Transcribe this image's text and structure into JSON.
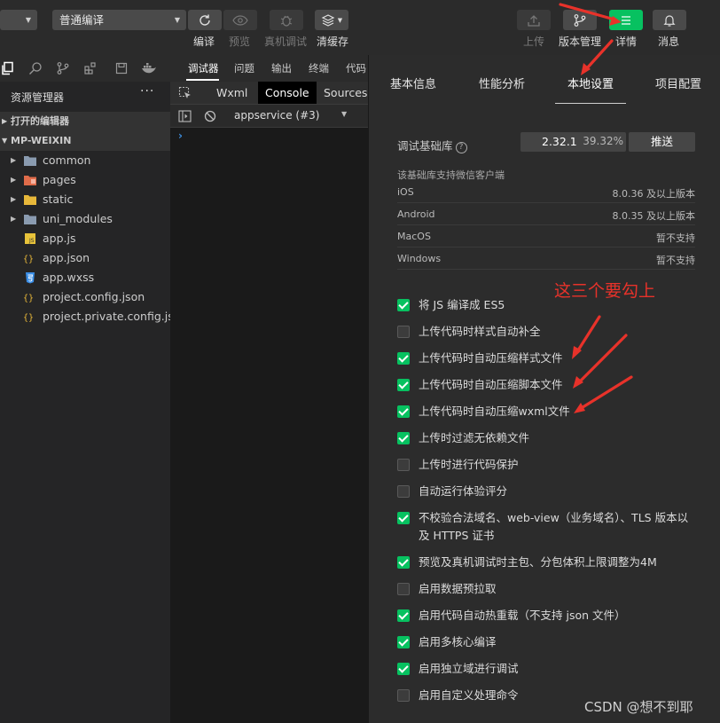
{
  "toolbar": {
    "compile_mode": "普通编译",
    "buttons": [
      {
        "label": "编译",
        "dim": false
      },
      {
        "label": "预览",
        "dim": true
      },
      {
        "label": "真机调试",
        "dim": true
      },
      {
        "label": "清缓存",
        "dim": false
      }
    ],
    "right_buttons": [
      {
        "label": "上传",
        "dim": true
      },
      {
        "label": "版本管理",
        "dim": false
      },
      {
        "label": "详情",
        "dim": false
      },
      {
        "label": "消息",
        "dim": false
      }
    ]
  },
  "sidebar": {
    "title": "资源管理器",
    "more": "···",
    "open_editors": "打开的编辑器",
    "project": "MP-WEIXIN",
    "items": [
      {
        "name": "common",
        "type": "folder"
      },
      {
        "name": "pages",
        "type": "folder-pages"
      },
      {
        "name": "static",
        "type": "folder-static"
      },
      {
        "name": "uni_modules",
        "type": "folder"
      },
      {
        "name": "app.js",
        "type": "js"
      },
      {
        "name": "app.json",
        "type": "json"
      },
      {
        "name": "app.wxss",
        "type": "wxss"
      },
      {
        "name": "project.config.json",
        "type": "json"
      },
      {
        "name": "project.private.config.js...",
        "type": "json"
      }
    ]
  },
  "debug": {
    "tabs": [
      "调试器",
      "问题",
      "输出",
      "终端",
      "代码"
    ],
    "devtools_tabs": [
      "Wxml",
      "Console",
      "Sources"
    ],
    "context": "appservice (#3)"
  },
  "details": {
    "tabs": [
      "基本信息",
      "性能分析",
      "本地设置",
      "项目配置"
    ],
    "lib_label": "调试基础库",
    "lib_version": "2.32.1",
    "lib_percent": "39.32%",
    "push_label": "推送",
    "support_title": "该基础库支持微信客户端",
    "support": [
      {
        "platform": "iOS",
        "value": "8.0.36 及以上版本"
      },
      {
        "platform": "Android",
        "value": "8.0.35 及以上版本"
      },
      {
        "platform": "MacOS",
        "value": "暂不支持"
      },
      {
        "platform": "Windows",
        "value": "暂不支持"
      }
    ],
    "options": [
      {
        "text": "将 JS 编译成 ES5",
        "checked": true
      },
      {
        "text": "上传代码时样式自动补全",
        "checked": false
      },
      {
        "text": "上传代码时自动压缩样式文件",
        "checked": true
      },
      {
        "text": "上传代码时自动压缩脚本文件",
        "checked": true
      },
      {
        "text": "上传代码时自动压缩wxml文件",
        "checked": true
      },
      {
        "text": "上传时过滤无依赖文件",
        "checked": true
      },
      {
        "text": "上传时进行代码保护",
        "checked": false
      },
      {
        "text": "自动运行体验评分",
        "checked": false
      },
      {
        "text": "不校验合法域名、web-view（业务域名）、TLS 版本以及 HTTPS 证书",
        "checked": true
      },
      {
        "text": "预览及真机调试时主包、分包体积上限调整为4M",
        "checked": true
      },
      {
        "text": "启用数据预拉取",
        "checked": false
      },
      {
        "text": "启用代码自动热重载（不支持 json 文件）",
        "checked": true
      },
      {
        "text": "启用多核心编译",
        "checked": true
      },
      {
        "text": "启用独立域进行调试",
        "checked": true
      },
      {
        "text": "启用自定义处理命令",
        "checked": false
      }
    ]
  },
  "annotation": "这三个要勾上",
  "watermark": "CSDN @想不到耶",
  "colors": {
    "accent": "#07c160",
    "annotation": "#e8322a"
  }
}
